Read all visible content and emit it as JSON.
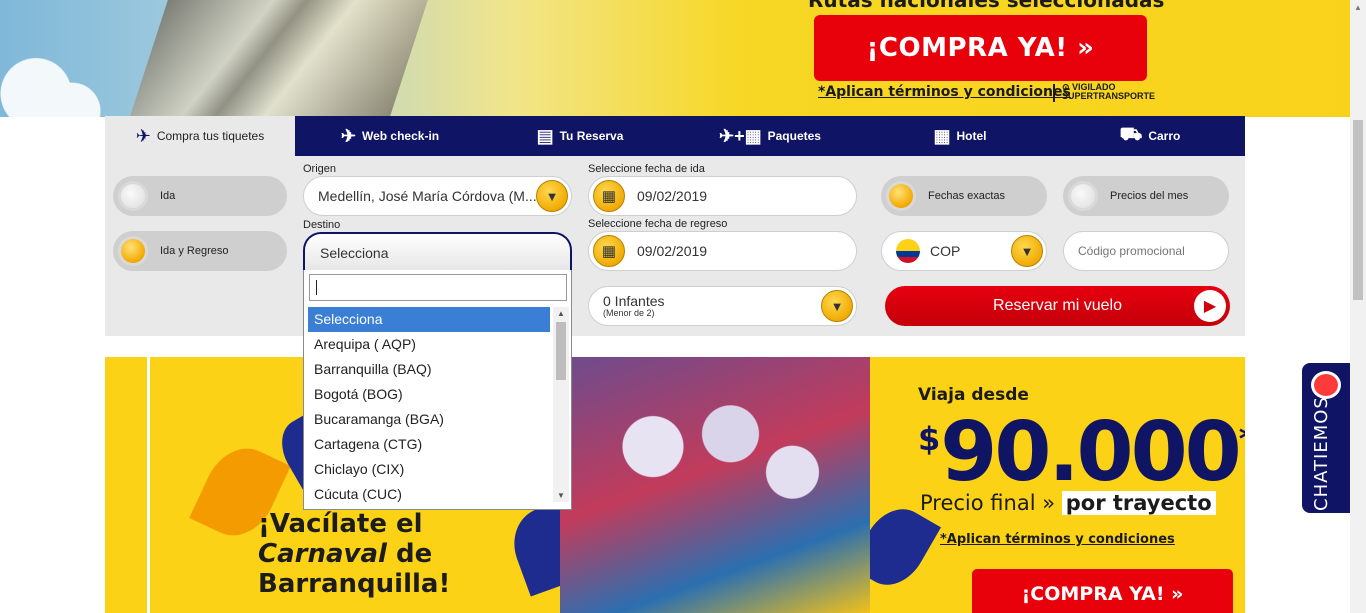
{
  "hero": {
    "headline": "Rutas nacionales seleccionadas",
    "buy_label": "¡COMPRA YA! »",
    "terms": "*Aplican términos y condiciones",
    "vigilado": "VIGILADO SUPERTRANSPORTE"
  },
  "tabs": [
    {
      "label": "Compra tus tiquetes",
      "icon": "plane-icon"
    },
    {
      "label": "Web check-in",
      "icon": "plane-checkin-icon"
    },
    {
      "label": "Tu Reserva",
      "icon": "reservation-icon"
    },
    {
      "label": "Paquetes",
      "icon": "plane-hotel-icon"
    },
    {
      "label": "Hotel",
      "icon": "hotel-icon"
    },
    {
      "label": "Carro",
      "icon": "car-icon"
    }
  ],
  "trip": {
    "ida": "Ida",
    "ida_regreso": "Ida y Regreso"
  },
  "origin": {
    "label": "Origen",
    "value": "Medellín, José María Córdova (M..."
  },
  "destination": {
    "label": "Destino",
    "value": "Selecciona",
    "search_value": "",
    "options": [
      "Selecciona",
      "Arequipa ( AQP)",
      "Barranquilla (BAQ)",
      "Bogotá (BOG)",
      "Bucaramanga (BGA)",
      "Cartagena (CTG)",
      "Chiclayo (CIX)",
      "Cúcuta (CUC)"
    ],
    "selected_index": 0
  },
  "dates": {
    "ida_label": "Seleccione fecha de ida",
    "ida_value": "09/02/2019",
    "regreso_label": "Seleccione fecha de regreso",
    "regreso_value": "09/02/2019"
  },
  "infants": {
    "value": "0 Infantes",
    "sub": "(Menor de 2)"
  },
  "options": {
    "fechas_exactas": "Fechas exactas",
    "precios_mes": "Precios del mes",
    "currency": "COP",
    "promo_placeholder": "Código promocional",
    "reserve_label": "Reservar mi vuelo"
  },
  "promo": {
    "carnival_line1": "¡Vacílate el",
    "carnival_line2": "Carnaval",
    "carnival_de": " de",
    "carnival_line3": "Barranquilla!",
    "from_label": "Viaja desde",
    "price": "90.000",
    "currency_symbol": "$",
    "asterisk": "*",
    "final_label": "Precio final »",
    "final_bold": "por trayecto",
    "terms": "*Aplican términos y condiciones",
    "buy_label": "¡COMPRA YA! »"
  },
  "chat": {
    "label": "CHATIEMOS"
  },
  "colors": {
    "navy": "#0f1464",
    "red": "#e8000a",
    "yellow": "#fbd215",
    "select_blue": "#3b7ed6"
  }
}
